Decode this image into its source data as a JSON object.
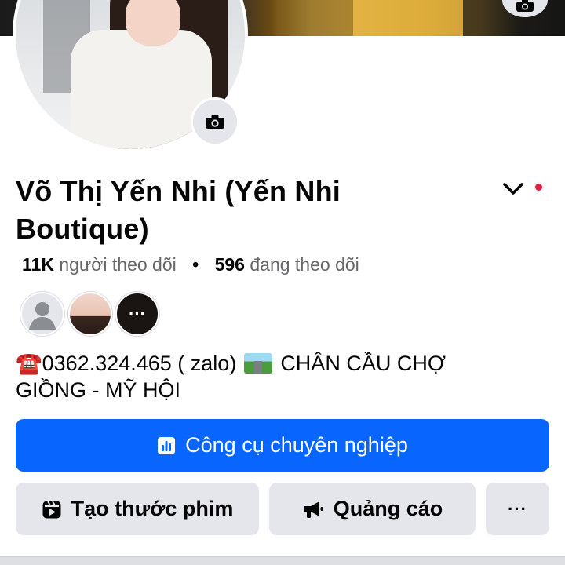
{
  "profile": {
    "name": "Võ Thị Yến Nhi (Yến Nhi Boutique)",
    "followers_count": "11K",
    "followers_label": "người theo dõi",
    "separator": "•",
    "following_count": "596",
    "following_label": "đang theo dõi",
    "friends_more": "···"
  },
  "bio": {
    "phone_emoji": "☎️",
    "phone_text": "0362.324.465 ( zalo)",
    "location_text": "CHÂN CẦU CHỢ GIỒNG - MỸ HỘI"
  },
  "actions": {
    "pro_tools": "Công cụ chuyên nghiệp",
    "create_reel": "Tạo thước phim",
    "ads": "Quảng cáo",
    "more": "···"
  },
  "icons": {
    "cover_camera": "camera-icon",
    "avatar_camera": "camera-icon",
    "menu": "chevron-down-icon",
    "pro_tools": "bar-chart-icon",
    "reel": "reel-icon",
    "ads": "megaphone-icon",
    "default_avatar": "person-icon"
  },
  "colors": {
    "primary": "#0866ff",
    "secondary_button": "#e4e6eb",
    "muted_text": "#65676b",
    "notification_dot": "#e41e3f"
  }
}
